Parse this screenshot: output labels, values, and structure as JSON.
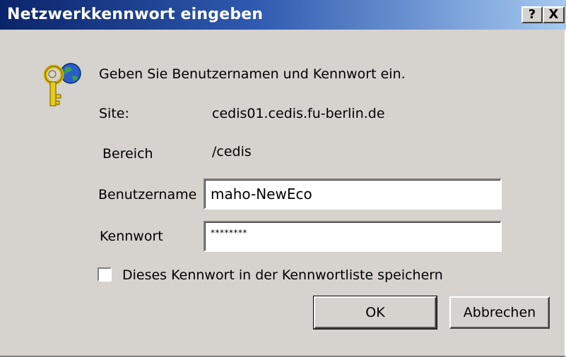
{
  "window": {
    "title": "Netzwerkkennwort eingeben",
    "help_button": "?",
    "close_button": "X"
  },
  "dialog": {
    "icon": "key-globe-icon",
    "instruction": "Geben Sie Benutzernamen und Kennwort ein.",
    "site_label": "Site:",
    "site_value": "cedis01.cedis.fu-berlin.de",
    "realm_label": "Bereich",
    "realm_value": "/cedis",
    "username_label": "Benutzername",
    "username_value": "maho-NewEco",
    "password_label": "Kennwort",
    "password_value": "********",
    "save_checkbox_label": "Dieses Kennwort in der Kennwortliste speichern",
    "save_checked": false,
    "ok_label": "OK",
    "cancel_label": "Abbrechen"
  }
}
